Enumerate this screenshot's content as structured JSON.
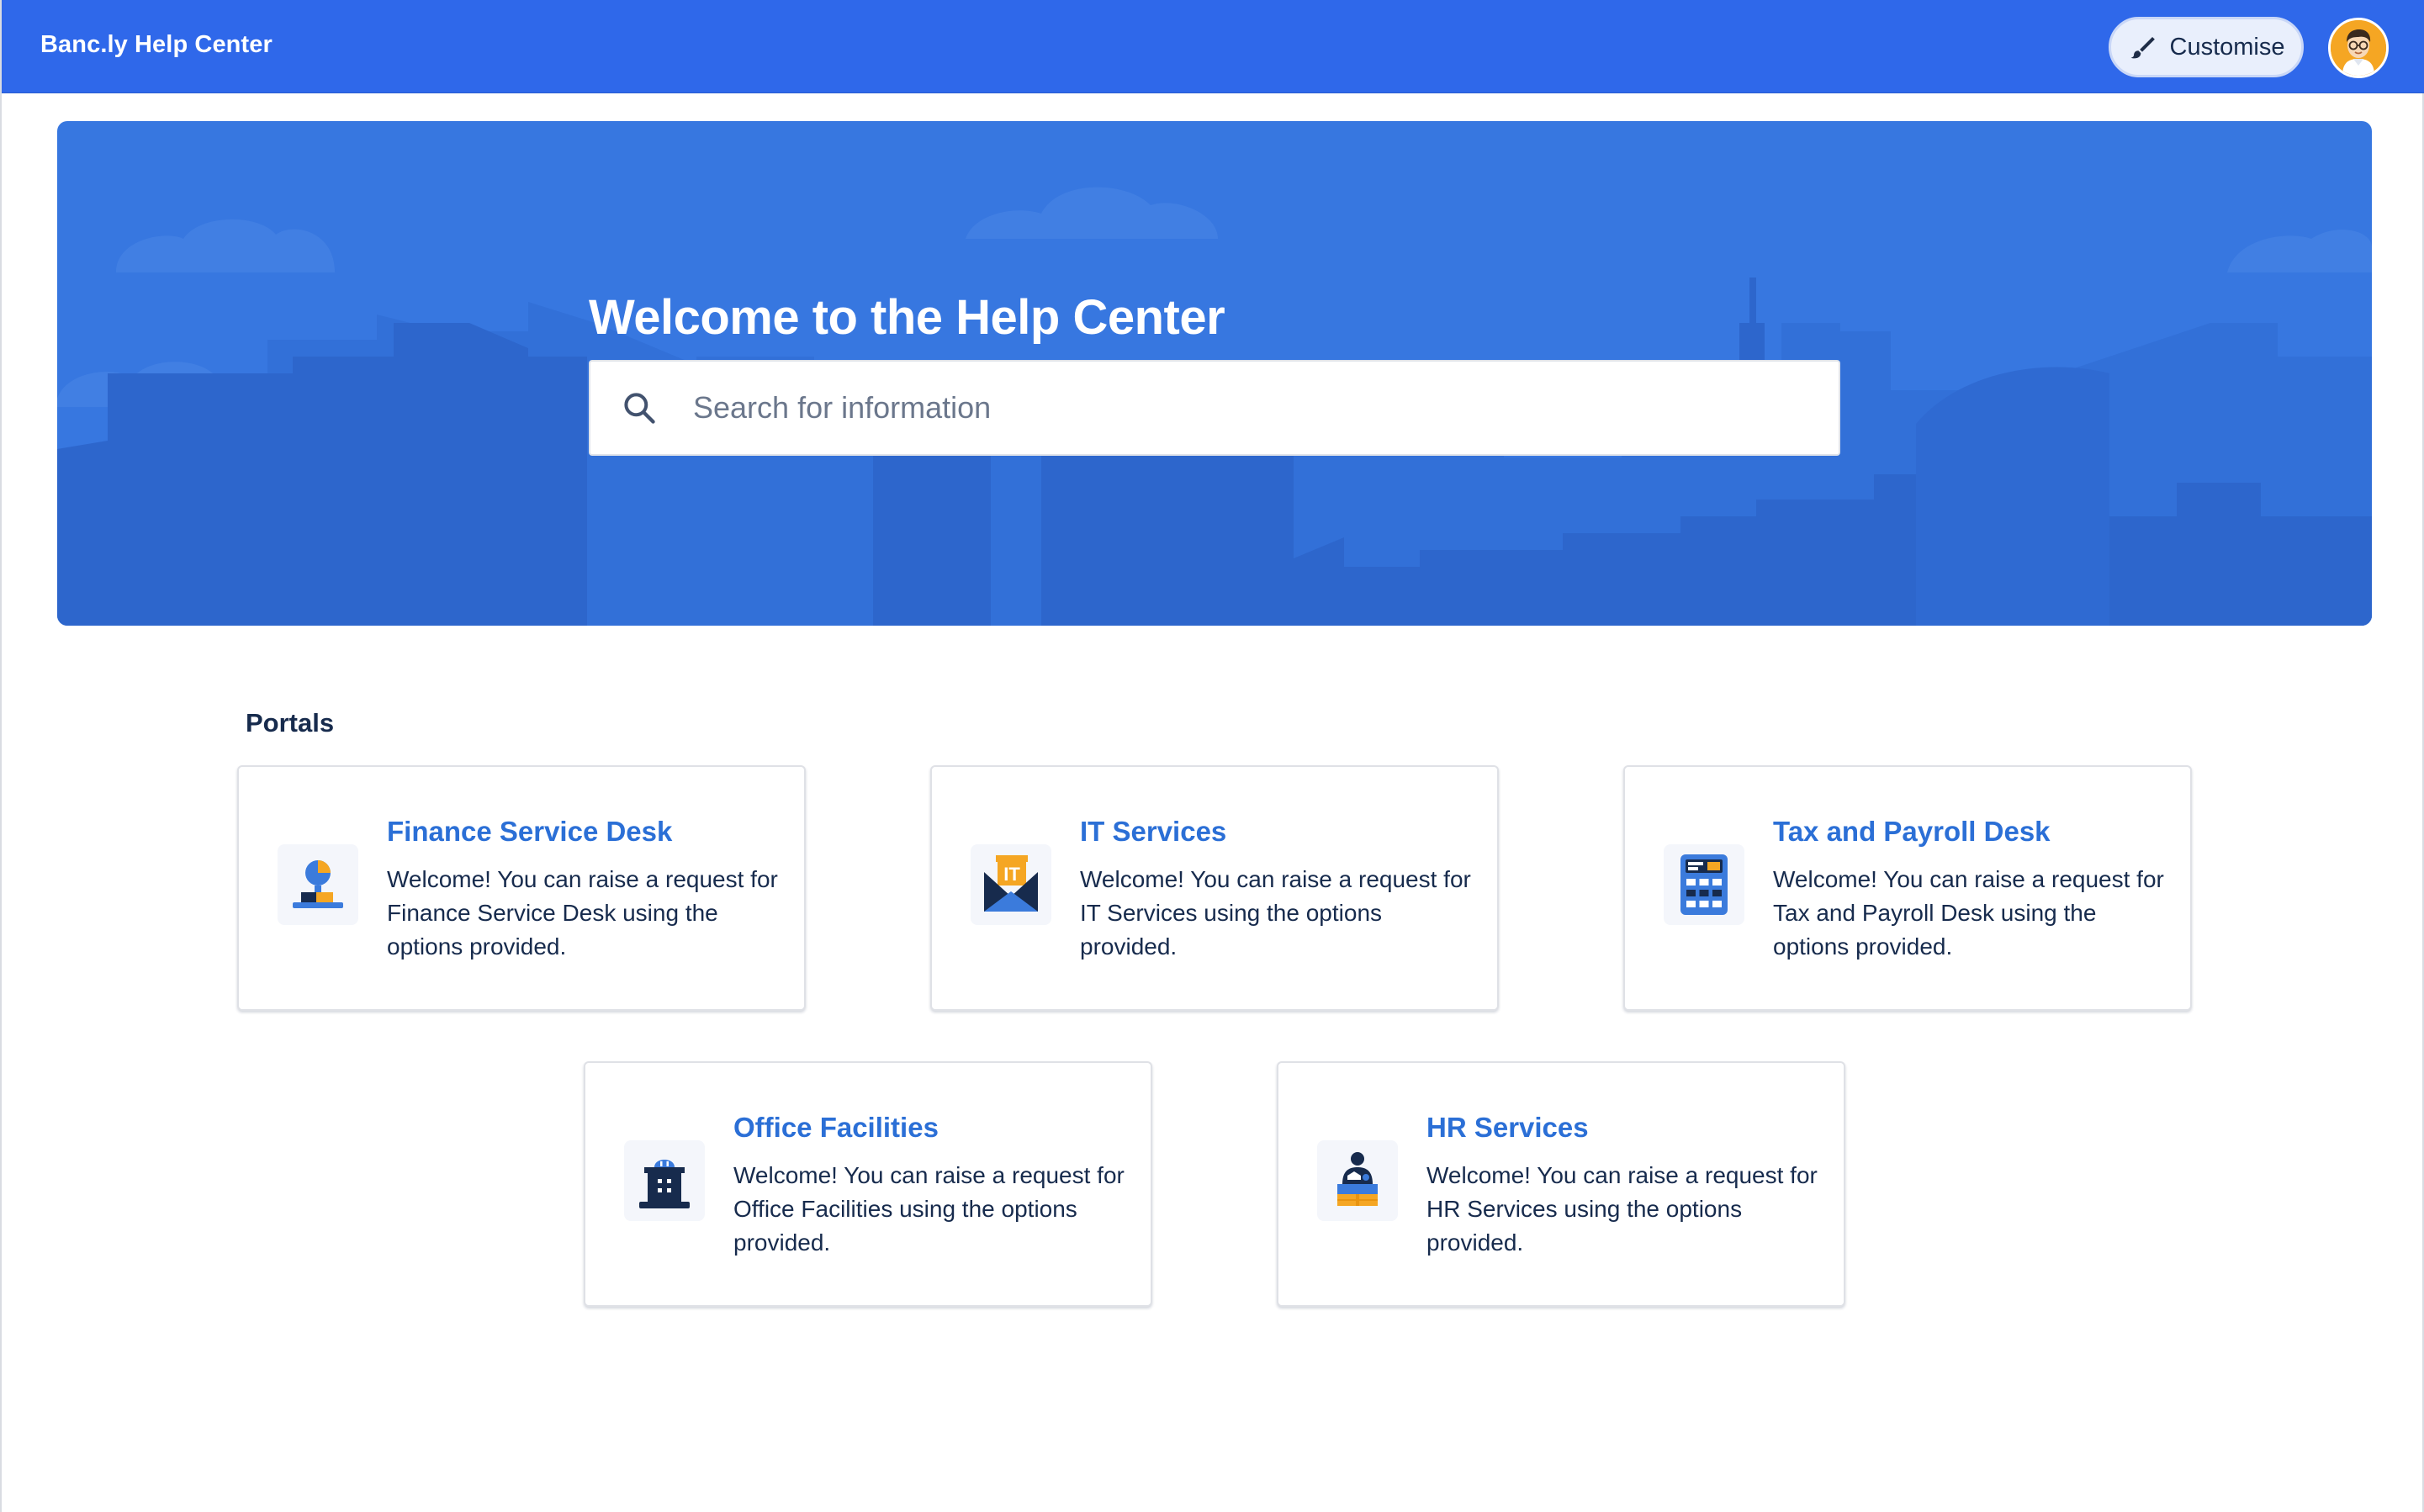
{
  "header": {
    "brand": "Banc.ly Help Center",
    "customise_label": "Customise",
    "customise_icon": "paintbrush-icon",
    "avatar_icon": "user-avatar-icon"
  },
  "hero": {
    "title": "Welcome to the Help Center",
    "search_placeholder": "Search for information",
    "search_value": "",
    "search_icon": "search-icon"
  },
  "portals": {
    "heading": "Portals",
    "items": [
      {
        "title": "Finance Service Desk",
        "description": "Welcome! You can raise a request for Finance Service Desk using the options provided.",
        "icon": "finance-desk-icon"
      },
      {
        "title": "IT Services",
        "description": "Welcome! You can raise a request for IT Services using the options provided.",
        "icon": "it-envelope-icon",
        "icon_text": "IT"
      },
      {
        "title": "Tax and Payroll Desk",
        "description": "Welcome! You can raise a request for Tax and Payroll Desk using the options provided.",
        "icon": "calculator-icon"
      },
      {
        "title": "Office Facilities",
        "description": "Welcome! You can raise a request for Office Facilities using the options provided.",
        "icon": "office-building-icon"
      },
      {
        "title": "HR Services",
        "description": "Welcome! You can raise a request for HR Services using the options provided.",
        "icon": "hr-desk-icon"
      }
    ]
  },
  "colors": {
    "topbar": "#2f68ea",
    "hero": "#3777e0",
    "link": "#2b6fd6",
    "text": "#172b4d",
    "accent_orange": "#f5a623"
  }
}
